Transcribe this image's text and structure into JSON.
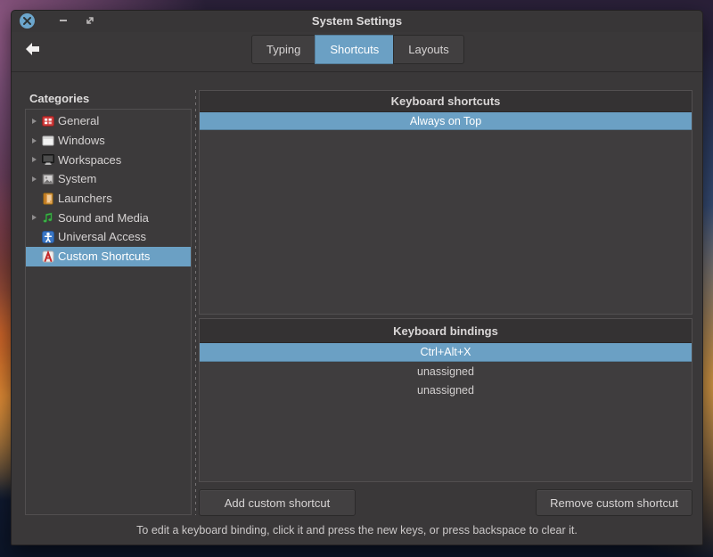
{
  "window": {
    "title": "System Settings",
    "titlebar": {
      "close_icon": "close-icon",
      "minimize_glyph": "–",
      "restore_glyph": "⤡"
    }
  },
  "toolbar": {
    "back_icon": "back-arrow-icon",
    "tabs": [
      {
        "label": "Typing",
        "active": false
      },
      {
        "label": "Shortcuts",
        "active": true
      },
      {
        "label": "Layouts",
        "active": false
      }
    ]
  },
  "sidebar": {
    "header": "Categories",
    "items": [
      {
        "label": "General",
        "icon": "general-icon",
        "expandable": true,
        "selected": false
      },
      {
        "label": "Windows",
        "icon": "windows-icon",
        "expandable": true,
        "selected": false
      },
      {
        "label": "Workspaces",
        "icon": "workspaces-icon",
        "expandable": true,
        "selected": false
      },
      {
        "label": "System",
        "icon": "system-icon",
        "expandable": true,
        "selected": false
      },
      {
        "label": "Launchers",
        "icon": "launchers-icon",
        "expandable": false,
        "selected": false
      },
      {
        "label": "Sound and Media",
        "icon": "sound-and-media-icon",
        "expandable": true,
        "selected": false
      },
      {
        "label": "Universal Access",
        "icon": "universal-access-icon",
        "expandable": false,
        "selected": false
      },
      {
        "label": "Custom Shortcuts",
        "icon": "custom-shortcuts-icon",
        "expandable": false,
        "selected": true
      }
    ]
  },
  "shortcuts_panel": {
    "header": "Keyboard shortcuts",
    "rows": [
      {
        "label": "Always on Top",
        "selected": true
      }
    ]
  },
  "bindings_panel": {
    "header": "Keyboard bindings",
    "rows": [
      {
        "label": "Ctrl+Alt+X",
        "selected": true
      },
      {
        "label": "unassigned",
        "selected": false
      },
      {
        "label": "unassigned",
        "selected": false
      }
    ]
  },
  "buttons": {
    "add_label": "Add custom shortcut",
    "remove_label": "Remove custom shortcut"
  },
  "footer": {
    "hint": "To edit a keyboard binding, click it and press the new keys, or press backspace to clear it."
  },
  "colors": {
    "accent_selection": "#6ba0c4",
    "close_button": "#6ca6cc",
    "window_bg": "#3a3839",
    "frame_body_bg": "#3f3d3e",
    "frame_header_bg": "#343233"
  }
}
